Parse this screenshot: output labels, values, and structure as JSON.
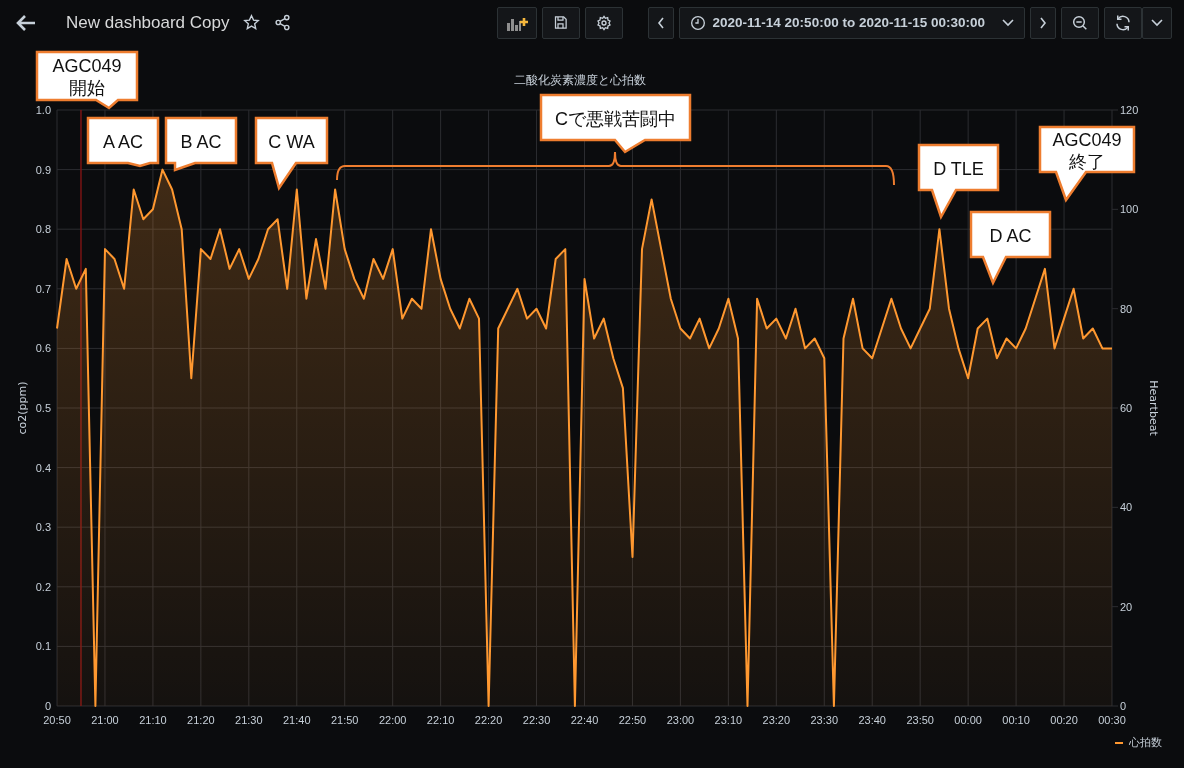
{
  "header": {
    "title": "New dashboard Copy",
    "time_range": "2020-11-14 20:50:00 to 2020-11-15 00:30:00"
  },
  "panel": {
    "chart_data": {
      "type": "area",
      "title": "二酸化炭素濃度と心拍数",
      "ylabel": "co2(ppm)",
      "y2label": "Heartbeat",
      "categories": [
        "20:50",
        null,
        null,
        null,
        null,
        "21:00",
        null,
        null,
        null,
        null,
        "21:10",
        null,
        null,
        null,
        null,
        "21:20",
        null,
        null,
        null,
        null,
        "21:30",
        null,
        null,
        null,
        null,
        "21:40",
        null,
        null,
        null,
        null,
        "21:50",
        null,
        null,
        null,
        null,
        "22:00",
        null,
        null,
        null,
        null,
        "22:10",
        null,
        null,
        null,
        null,
        "22:20",
        null,
        null,
        null,
        null,
        "22:30",
        null,
        null,
        null,
        null,
        "22:40",
        null,
        null,
        null,
        null,
        "22:50",
        null,
        null,
        null,
        null,
        "23:00",
        null,
        null,
        null,
        null,
        "23:10",
        null,
        null,
        null,
        null,
        "23:20",
        null,
        null,
        null,
        null,
        "23:30",
        null,
        null,
        null,
        null,
        "23:40",
        null,
        null,
        null,
        null,
        "23:50",
        null,
        null,
        null,
        null,
        "00:00",
        null,
        null,
        null,
        null,
        "00:10",
        null,
        null,
        null,
        null,
        "00:20",
        null,
        null,
        null,
        null,
        "00:30"
      ],
      "ylim": [
        0,
        1
      ],
      "y2lim": [
        0,
        120
      ],
      "grid": true,
      "yticks": [
        {
          "value": 0,
          "label": "0"
        },
        {
          "value": 0.1,
          "label": "0.1"
        },
        {
          "value": 0.2,
          "label": "0.2"
        },
        {
          "value": 0.3,
          "label": "0.3"
        },
        {
          "value": 0.4,
          "label": "0.4"
        },
        {
          "value": 0.5,
          "label": "0.5"
        },
        {
          "value": 0.6,
          "label": "0.6"
        },
        {
          "value": 0.7,
          "label": "0.7"
        },
        {
          "value": 0.8,
          "label": "0.8"
        },
        {
          "value": 0.9,
          "label": "0.9"
        },
        {
          "value": 1,
          "label": "1.0"
        }
      ],
      "y2ticks": [
        0,
        20,
        40,
        60,
        80,
        100,
        120
      ],
      "series": [
        {
          "name": "心拍数",
          "color": "#ff9830",
          "axis": "y2",
          "values": [
            76,
            90,
            84,
            88,
            0,
            92,
            90,
            84,
            104,
            98,
            100,
            108,
            104,
            96,
            66,
            92,
            90,
            96,
            88,
            92,
            86,
            90,
            96,
            98,
            84,
            104,
            82,
            94,
            84,
            104,
            92,
            86,
            82,
            90,
            86,
            92,
            78,
            82,
            80,
            96,
            86,
            80,
            76,
            82,
            78,
            0,
            76,
            80,
            84,
            78,
            80,
            76,
            90,
            92,
            0,
            86,
            74,
            78,
            70,
            64,
            30,
            92,
            102,
            92,
            82,
            76,
            74,
            78,
            72,
            76,
            82,
            74,
            0,
            82,
            76,
            78,
            74,
            80,
            72,
            74,
            70,
            0,
            74,
            82,
            72,
            70,
            76,
            82,
            76,
            72,
            76,
            80,
            96,
            80,
            72,
            66,
            76,
            78,
            70,
            74,
            72,
            76,
            82,
            88,
            72,
            78,
            84,
            74,
            76,
            72,
            72
          ]
        }
      ],
      "annotations": [
        "AGC049\n開始",
        "A AC",
        "B AC",
        "C WA",
        "Cで悪戦苦闘中",
        "D TLE",
        "D AC",
        "AGC049\n終了"
      ]
    }
  }
}
